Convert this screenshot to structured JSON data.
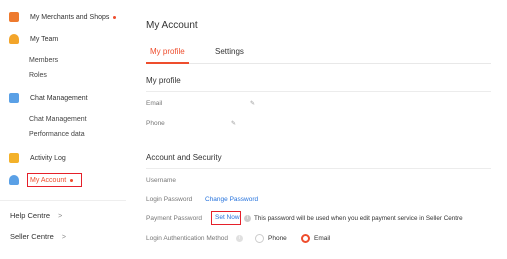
{
  "sidebar": {
    "merchants_label": "My Merchants and Shops",
    "team_label": "My Team",
    "members_label": "Members",
    "roles_label": "Roles",
    "chat_label": "Chat Management",
    "chat_sub_label": "Chat Management",
    "performance_label": "Performance data",
    "activity_label": "Activity Log",
    "account_label": "My Account",
    "help_label": "Help Centre",
    "seller_label": "Seller Centre",
    "chevron": ">"
  },
  "main": {
    "title": "My Account",
    "tabs": [
      {
        "label": "My profile"
      },
      {
        "label": "Settings"
      }
    ],
    "profile_title": "My profile",
    "email_label": "Email",
    "phone_label": "Phone",
    "security_title": "Account and Security",
    "username_label": "Username",
    "login_password_label": "Login Password",
    "change_password_link": "Change Password",
    "payment_password_label": "Payment Password",
    "set_now_link": "Set Now",
    "payment_info": "This password will be used when you edit payment service in Seller Centre",
    "login_auth_label": "Login Authentication Method",
    "auth_options": [
      {
        "label": "Phone",
        "selected": false
      },
      {
        "label": "Email",
        "selected": true
      }
    ]
  },
  "colors": {
    "accent": "#ee4d2d",
    "link": "#2673dd",
    "highlight_box": "#e5202a"
  }
}
